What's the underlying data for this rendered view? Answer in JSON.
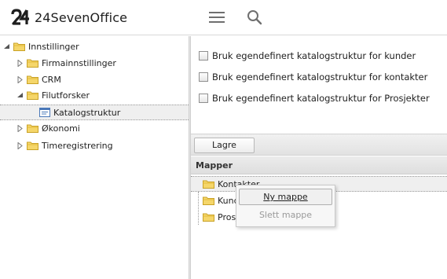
{
  "header": {
    "app_name": "24SevenOffice",
    "menu_icon": "hamburger-icon",
    "search_icon": "search-icon"
  },
  "tree": {
    "root": "Innstillinger",
    "items": [
      {
        "label": "Firmainnstillinger",
        "expanded": false
      },
      {
        "label": "CRM",
        "expanded": false
      },
      {
        "label": "Filutforsker",
        "expanded": true
      },
      {
        "label": "Katalogstruktur",
        "selected": true
      },
      {
        "label": "Økonomi",
        "expanded": false
      },
      {
        "label": "Timeregistrering",
        "expanded": false
      }
    ]
  },
  "settings": {
    "options": [
      {
        "label": "Bruk egendefinert katalogstruktur for kunder",
        "checked": false
      },
      {
        "label": "Bruk egendefinert katalogstruktur for kontakter",
        "checked": false
      },
      {
        "label": "Bruk egendefinert katalogstruktur for Prosjekter",
        "checked": false
      }
    ],
    "save_label": "Lagre"
  },
  "folders": {
    "header": "Mapper",
    "items": [
      {
        "label": "Kontakter"
      },
      {
        "label": "Kunder"
      },
      {
        "label": "Prosjekter"
      }
    ]
  },
  "context_menu": {
    "items": [
      {
        "label": "Ny mappe",
        "enabled": true
      },
      {
        "label": "Slett mappe",
        "enabled": false
      }
    ]
  },
  "colors": {
    "folder_fill": "#f5d66a",
    "folder_stroke": "#c9a227",
    "selection_bg": "#efefef",
    "panel_header_bg": "#e4e4e4"
  }
}
